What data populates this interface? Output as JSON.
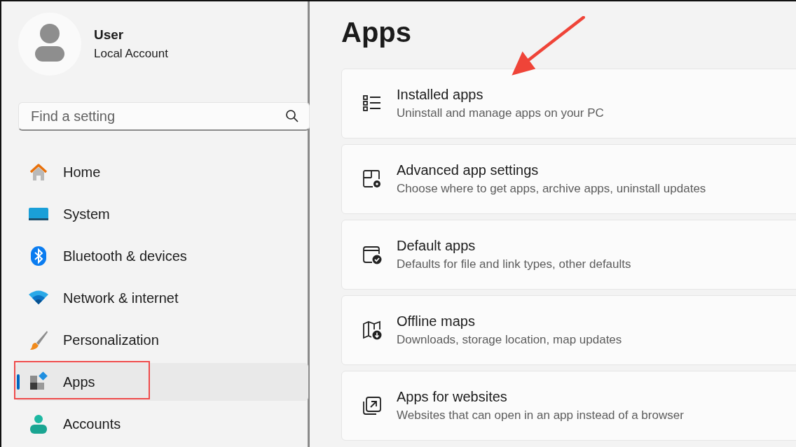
{
  "user": {
    "name": "User",
    "account": "Local Account"
  },
  "search": {
    "placeholder": "Find a setting"
  },
  "nav": [
    {
      "kind": "home",
      "label": "Home",
      "selected": false,
      "highlighted": false
    },
    {
      "kind": "system",
      "label": "System",
      "selected": false,
      "highlighted": false
    },
    {
      "kind": "bluetooth",
      "label": "Bluetooth & devices",
      "selected": false,
      "highlighted": false
    },
    {
      "kind": "network",
      "label": "Network & internet",
      "selected": false,
      "highlighted": false
    },
    {
      "kind": "personalization",
      "label": "Personalization",
      "selected": false,
      "highlighted": false
    },
    {
      "kind": "apps",
      "label": "Apps",
      "selected": true,
      "highlighted": true
    },
    {
      "kind": "accounts",
      "label": "Accounts",
      "selected": false,
      "highlighted": false
    }
  ],
  "page_title": "Apps",
  "cards": [
    {
      "kind": "installed",
      "title": "Installed apps",
      "subtitle": "Uninstall and manage apps on your PC",
      "pointed": true
    },
    {
      "kind": "advanced",
      "title": "Advanced app settings",
      "subtitle": "Choose where to get apps, archive apps, uninstall updates",
      "pointed": false
    },
    {
      "kind": "default",
      "title": "Default apps",
      "subtitle": "Defaults for file and link types, other defaults",
      "pointed": false
    },
    {
      "kind": "offline",
      "title": "Offline maps",
      "subtitle": "Downloads, storage location, map updates",
      "pointed": false
    },
    {
      "kind": "websites",
      "title": "Apps for websites",
      "subtitle": "Websites that can open in an app instead of a browser",
      "pointed": false
    }
  ]
}
